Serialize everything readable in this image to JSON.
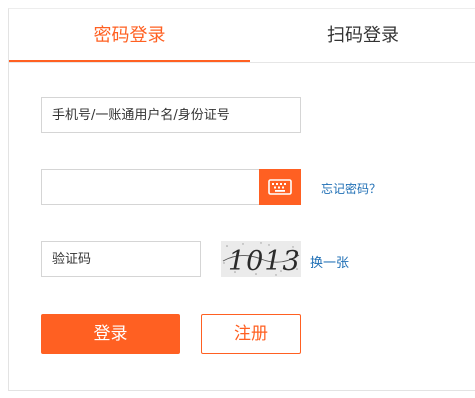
{
  "tabs": {
    "password_login": "密码登录",
    "qr_login": "扫码登录"
  },
  "form": {
    "username_placeholder": "手机号/一账通用户名/身份证号",
    "password_placeholder": "",
    "keyboard_icon": "keyboard-icon",
    "forgot_password": "忘记密码？",
    "captcha_placeholder": "验证码",
    "captcha_text": "1013",
    "refresh_captcha": "换一张",
    "login_button": "登录",
    "register_button": "注册"
  },
  "colors": {
    "accent": "#ff6022",
    "link": "#1f6fb5"
  }
}
